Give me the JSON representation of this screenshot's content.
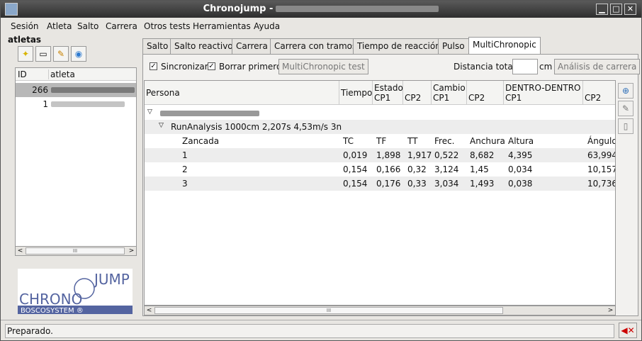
{
  "window": {
    "title": "Chronojump -"
  },
  "menu": [
    "Sesión",
    "Atleta",
    "Salto",
    "Carrera",
    "Otros tests",
    "Herramientas",
    "Ayuda"
  ],
  "left": {
    "title": "atletas",
    "columns": [
      "ID",
      "atleta"
    ],
    "rows": [
      {
        "id": "266"
      },
      {
        "id": "1"
      }
    ]
  },
  "tabs": [
    "Salto",
    "Salto reactivo",
    "Carrera",
    "Carrera con tramos",
    "Tiempo de reacción",
    "Pulso",
    "MultiChronopic"
  ],
  "controls": {
    "sync_label": "Sincronizar",
    "delete_first_label": "Borrar primero",
    "test_button": "MultiChronopic test",
    "distance_label": "Distancia total",
    "distance_unit": "cm",
    "analysis_button": "Análisis de carrera"
  },
  "grid": {
    "headers": {
      "persona": "Persona",
      "tiempo": "Tiempo",
      "estado": "Estado",
      "cp1a": "CP1",
      "cp2a": "CP2",
      "cambio": "Cambio",
      "cp1b": "CP1",
      "cp2b": "CP2",
      "dentro": "DENTRO-DENTRO",
      "cp1c": "CP1",
      "cp2c": "CP2"
    },
    "test_row": "RunAnalysis 1000cm 2,207s 4,53m/s 3n",
    "sub_headers": [
      "Zancada",
      "TC",
      "TF",
      "TT",
      "Frec.",
      "Anchura",
      "Altura",
      "Ángulo"
    ],
    "rows": [
      [
        "1",
        "0,019",
        "1,898",
        "1,917",
        "0,522",
        "8,682",
        "4,395",
        "63,994"
      ],
      [
        "2",
        "0,154",
        "0,166",
        "0,32",
        "3,124",
        "1,45",
        "0,034",
        "10,157"
      ],
      [
        "3",
        "0,154",
        "0,176",
        "0,33",
        "3,034",
        "1,493",
        "0,038",
        "10,736"
      ]
    ]
  },
  "logo": {
    "text1": "CHRONO",
    "text2": "JUMP",
    "text3": "BOSCOSYSTEM ®"
  },
  "status": {
    "text": "Preparado."
  }
}
